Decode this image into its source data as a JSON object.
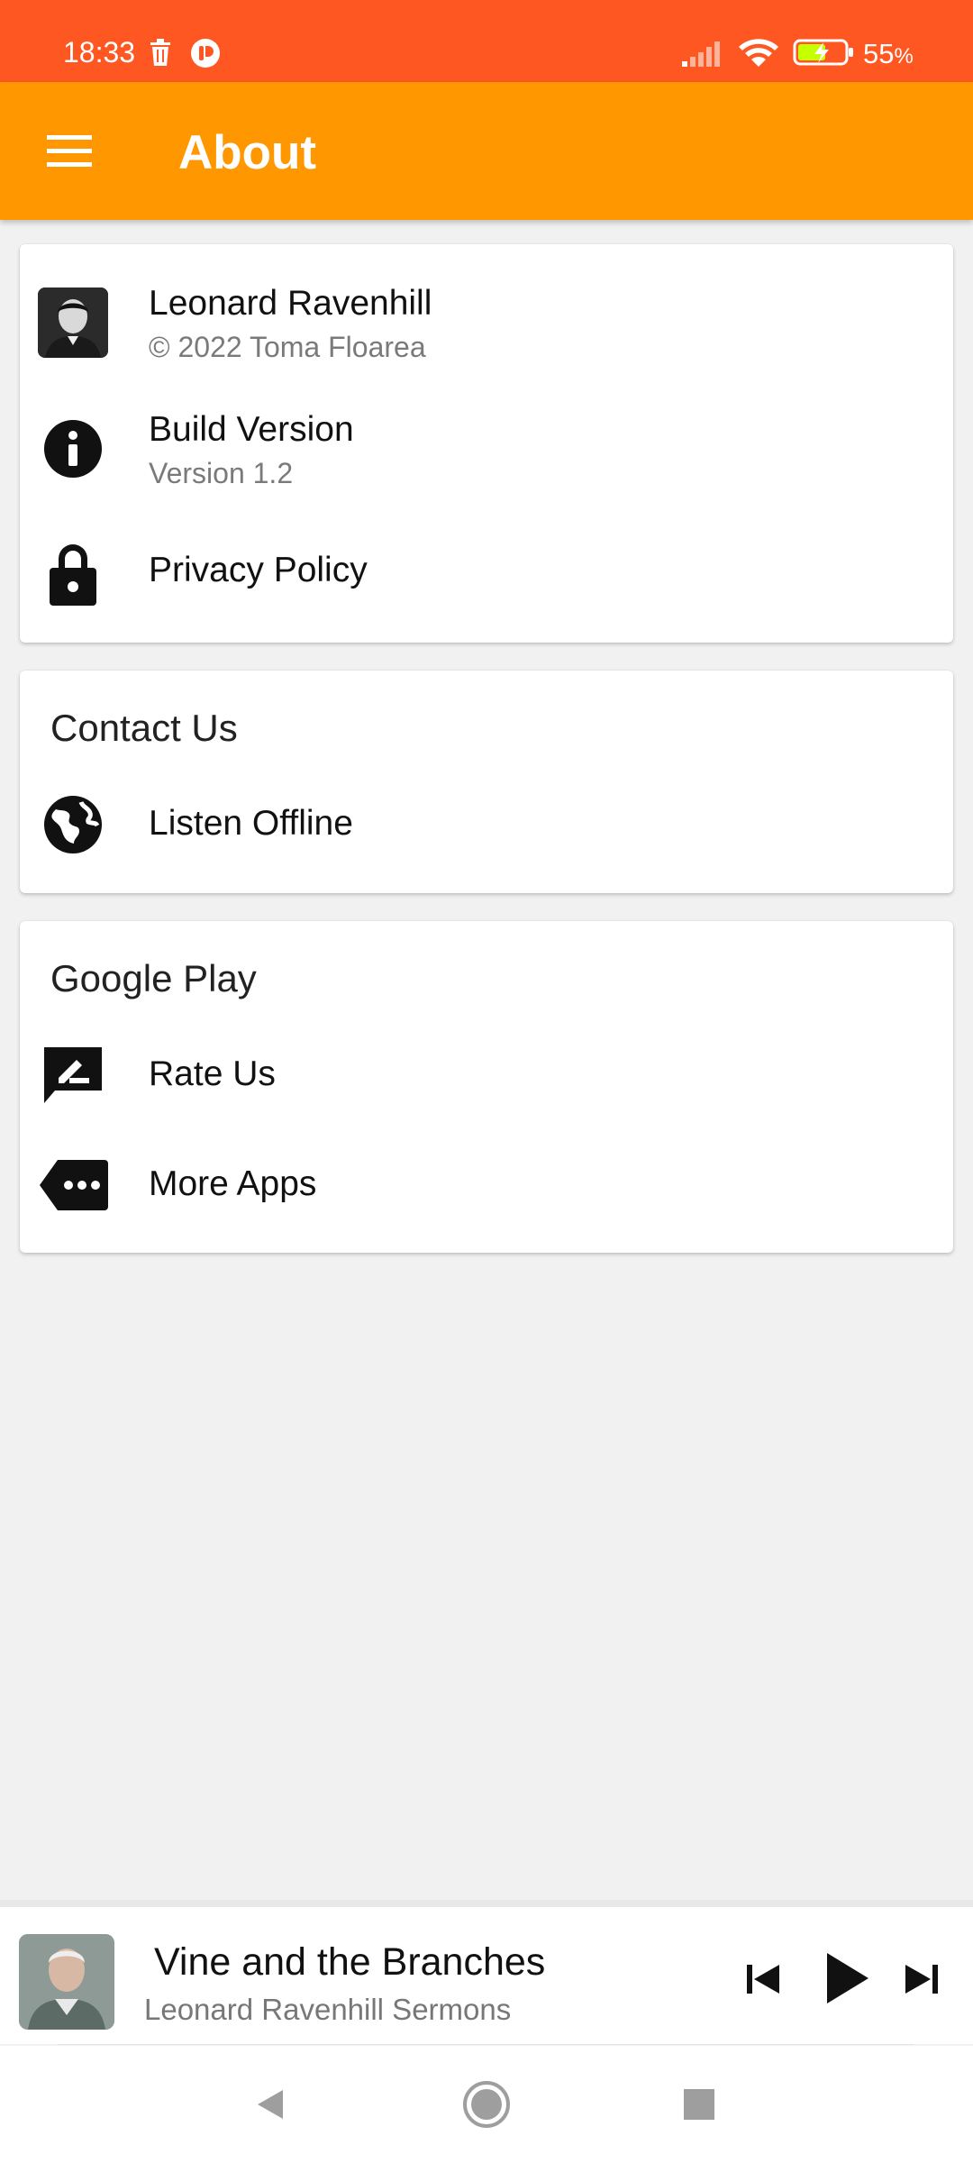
{
  "status_bar": {
    "time": "18:33",
    "battery_percent": "55",
    "battery_suffix": "%"
  },
  "app_bar": {
    "title": "About"
  },
  "about_card": {
    "author_name": "Leonard Ravenhill",
    "copyright": "© 2022 Toma Floarea",
    "build_label": "Build Version",
    "build_value": "Version 1.2",
    "privacy_label": "Privacy Policy"
  },
  "contact_card": {
    "header": "Contact Us",
    "item_label": "Listen Offline"
  },
  "play_card": {
    "header": "Google Play",
    "rate_label": "Rate Us",
    "more_label": "More Apps"
  },
  "player": {
    "title": "Vine and the Branches",
    "subtitle": "Leonard Ravenhill Sermons"
  },
  "colors": {
    "status_bar": "#ff5722",
    "app_bar": "#ff9800",
    "background": "#f1f1f1"
  }
}
